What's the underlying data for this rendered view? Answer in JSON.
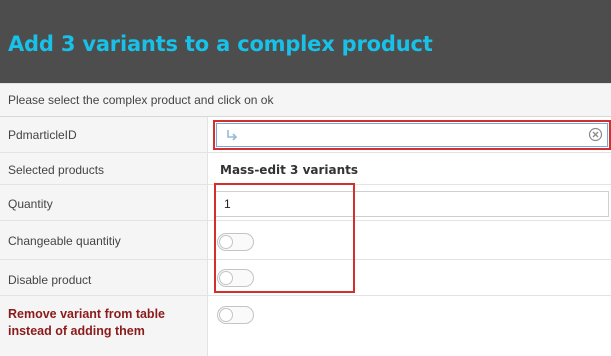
{
  "dialog": {
    "title": "Add 3 variants to a complex product",
    "instruction": "Please select the complex product and click on ok"
  },
  "fields": {
    "pdmarticle": {
      "label": "PdmarticleID",
      "value": ""
    },
    "selected_products": {
      "label": "Selected products",
      "value": "Mass-edit 3 variants"
    },
    "quantity": {
      "label": "Quantity",
      "value": "1"
    },
    "changeable_quantity": {
      "label": "Changeable quantitiy",
      "checked": false
    },
    "disable_product": {
      "label": "Disable product",
      "checked": false
    },
    "remove_variant": {
      "label": "Remove variant from table instead of adding them",
      "checked": false
    }
  },
  "icons": {
    "lookup": "arrow-return-icon",
    "clear": "clear-circle-icon"
  },
  "colors": {
    "header_bg": "#4d4d4d",
    "title": "#17c1e8",
    "highlight": "#d32f2f",
    "emphasis_label": "#8b1a1a"
  }
}
